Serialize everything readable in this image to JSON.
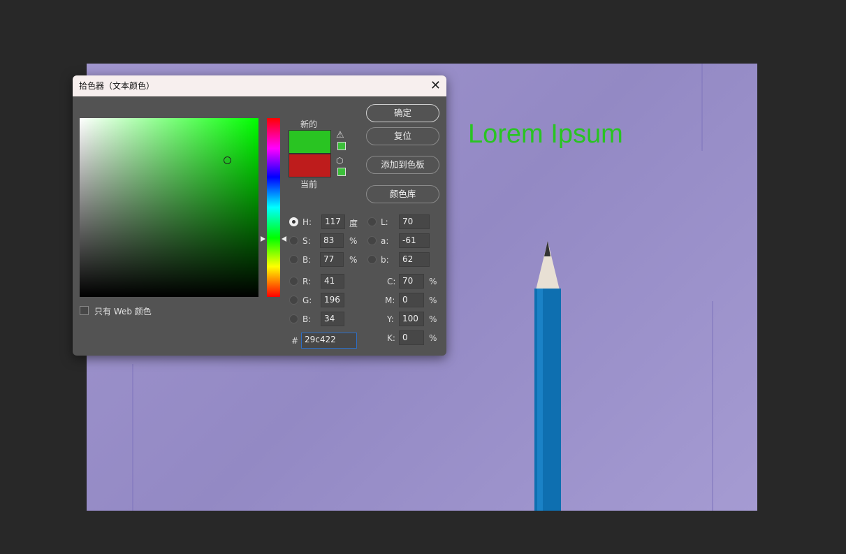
{
  "canvas": {
    "text": "Lorem Ipsum",
    "text_color": "#29c422"
  },
  "dialog": {
    "title": "拾色器（文本颜色）",
    "close_icon": "close-icon",
    "new_label": "新的",
    "current_label": "当前",
    "new_color": "#29c422",
    "current_color": "#be1c1c",
    "buttons": {
      "ok": "确定",
      "reset": "复位",
      "add_swatch": "添加到色板",
      "libraries": "颜色库"
    },
    "web_only": "只有 Web 颜色",
    "fields": {
      "H": {
        "label": "H:",
        "value": "117",
        "unit": "度"
      },
      "S": {
        "label": "S:",
        "value": "83",
        "unit": "%"
      },
      "Bv": {
        "label": "B:",
        "value": "77",
        "unit": "%"
      },
      "R": {
        "label": "R:",
        "value": "41"
      },
      "G": {
        "label": "G:",
        "value": "196"
      },
      "B": {
        "label": "B:",
        "value": "34"
      },
      "L": {
        "label": "L:",
        "value": "70"
      },
      "a": {
        "label": "a:",
        "value": "-61"
      },
      "b": {
        "label": "b:",
        "value": "62"
      },
      "C": {
        "label": "C:",
        "value": "70",
        "unit": "%"
      },
      "M": {
        "label": "M:",
        "value": "0",
        "unit": "%"
      },
      "Y": {
        "label": "Y:",
        "value": "100",
        "unit": "%"
      },
      "K": {
        "label": "K:",
        "value": "0",
        "unit": "%"
      },
      "hex": {
        "label": "#",
        "value": "29c422"
      }
    }
  }
}
